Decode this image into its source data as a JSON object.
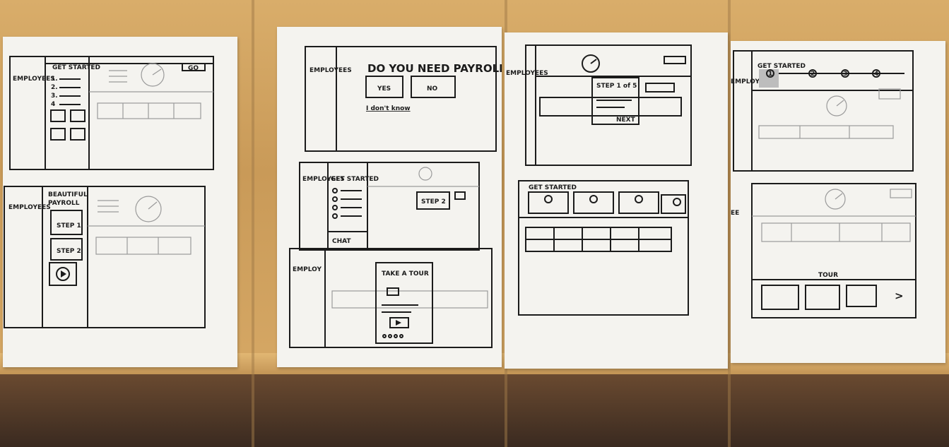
{
  "sketches": {
    "s1": {
      "sidebar": "EMPLOYEES",
      "title": "GET STARTED",
      "list": [
        "1.",
        "2.",
        "3.",
        "4"
      ],
      "corner": "GO"
    },
    "s2": {
      "sidebar": "EMPLOYEES",
      "title_line1": "BEAUTIFUL",
      "title_line2": "PAYROLL",
      "step1": "STEP 1",
      "step2": "STEP 2"
    },
    "s3": {
      "sidebar": "EMPLOYEES",
      "question": "DO YOU NEED PAYROLL?",
      "yes": "YES",
      "no": "NO",
      "dont_know": "I don't know"
    },
    "s4": {
      "sidebar": "EMPLOYEES",
      "title": "GET STARTED",
      "step2": "STEP 2",
      "chat": "CHAT"
    },
    "s5": {
      "sidebar": "EMPLOY",
      "title": "TAKE A TOUR"
    },
    "s6": {
      "sidebar": "EMPLOYEES",
      "step": "STEP 1 of 5",
      "next": "NEXT"
    },
    "s7": {
      "title": "GET STARTED"
    },
    "s8": {
      "sidebar": "EMPLOYEES",
      "title": "GET STARTED",
      "steps": [
        "1",
        "2",
        "3",
        "4"
      ]
    },
    "s9": {
      "sidebar": "EE",
      "tour": "TOUR",
      "arrow": ">"
    }
  }
}
